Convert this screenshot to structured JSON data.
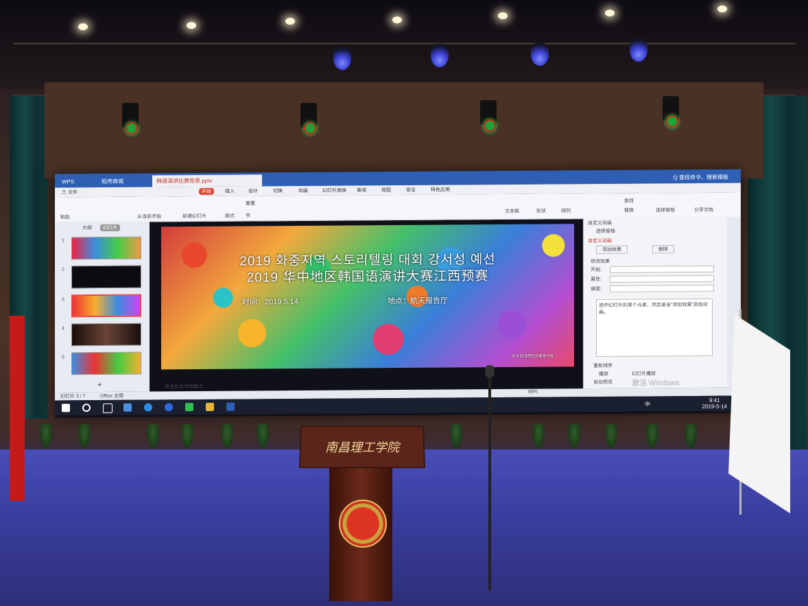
{
  "window": {
    "tabs": [
      "WPS",
      "稻壳商城",
      "韩语演讲比赛背景.pptx"
    ],
    "search_hint": "Q 查找命令、搜索模板"
  },
  "menu": {
    "items": [
      "三 文件",
      "开始",
      "插入",
      "设计",
      "切换",
      "动画",
      "幻灯片放映",
      "审阅",
      "视图",
      "安全",
      "特色应用"
    ]
  },
  "ribbon": {
    "items": [
      "粘贴",
      "从当前开始",
      "新建幻灯片",
      "版式",
      "节",
      "重置",
      "文本框",
      "形状",
      "排列",
      "查找",
      "替换",
      "选择窗格",
      "分享文档"
    ]
  },
  "outline": {
    "tabs": [
      "大纲",
      "幻灯片"
    ],
    "slide_numbers": [
      "1",
      "2",
      "3",
      "4",
      "5"
    ],
    "add_symbol": "+"
  },
  "slide": {
    "title_korean": "2019 화중지역 스토리텔링 대회 강서성 예선",
    "title_chinese": "2019 华中地区韩国语演讲大赛江西预赛",
    "time": "时间：2019.5.14",
    "place": "地点：航天报告厅",
    "logo_text": "주우한대한민국총영사관"
  },
  "animation_pane": {
    "title": "自定义动画",
    "select_pane": "选择窗格",
    "section": "自定义动画",
    "add_effect": "添加效果",
    "delete": "删除",
    "modify": "修改效果",
    "start": "开始:",
    "property": "属性:",
    "speed": "速度:",
    "description": "选中幻灯片的某个元素，然后单击“添加效果”添加动画。",
    "reorder": "重新排序",
    "play": "播放",
    "slideshow": "幻灯片播放",
    "autopreview": "自动预览",
    "windows_watermark": "激活 Windows"
  },
  "status": {
    "slide_counter": "幻灯片 3 / 7",
    "theme": "Office 主题",
    "notes_hint": "单击此处添加备注",
    "zoom": "68%"
  },
  "taskbar": {
    "time": "9:41",
    "date": "2019-5-14",
    "lang": "中"
  },
  "podium": {
    "sign": "南昌理工学院"
  }
}
